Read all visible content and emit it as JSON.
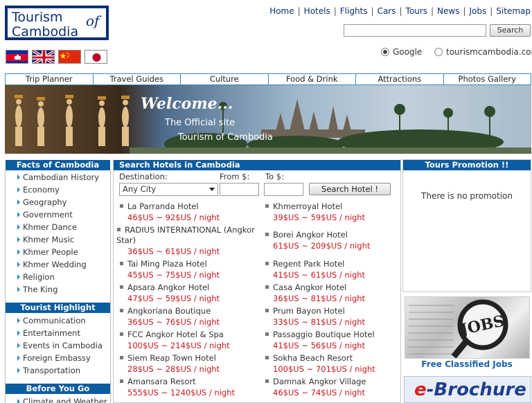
{
  "logo": {
    "line1": "Tourism",
    "line2": "Cambodia",
    "suffix": "of"
  },
  "topnav": [
    "Home",
    "Hotels",
    "Flights",
    "Cars",
    "Tours",
    "News",
    "Jobs",
    "Sitemap"
  ],
  "search": {
    "button": "Search",
    "value": ""
  },
  "search_scope": {
    "options": [
      "Google",
      "tourismcambodia.com"
    ],
    "selected": "Google"
  },
  "languages": [
    "khmer-flag-icon",
    "uk-flag-icon",
    "china-flag-icon",
    "japan-flag-icon"
  ],
  "main_menu": [
    "Trip Planner",
    "Travel Guides",
    "Culture",
    "Food & Drink",
    "Attractions",
    "Photos Gallery"
  ],
  "banner": {
    "welcome": "Welcome...",
    "line1": "The Official site",
    "line2": "Tourism of Cambodia"
  },
  "facts": {
    "title": "Facts of Cambodia",
    "items": [
      "Cambodian History",
      "Economy",
      "Geography",
      "Government",
      "Khmer Dance",
      "Khmer Music",
      "Khmer People",
      "Khmer Wedding",
      "Religion",
      "The King"
    ]
  },
  "highlight": {
    "title": "Tourist Highlight",
    "items": [
      "Communication",
      "Entertainment",
      "Events in Cambodia",
      "Foreign Embassy",
      "Transportation"
    ]
  },
  "before_you_go": {
    "title": "Before You Go",
    "items": [
      "Climate and Weather"
    ]
  },
  "hotel_search": {
    "title": "Search Hotels in Cambodia",
    "destination_label": "Destination:",
    "from_label": "From $:",
    "to_label": "To $:",
    "destination_value": "Any City",
    "button": "Search Hotel !",
    "hotels_left": [
      {
        "name": "La Parranda Hotel",
        "price": "46$US ~ 92$US / night"
      },
      {
        "name": "RADIUS INTERNATIONAL (Angkor",
        "name2": "Star)",
        "price": "36$US ~ 61$US / night"
      },
      {
        "name": "Tai Ming Plaza Hotel",
        "price": "45$US ~ 75$US / night"
      },
      {
        "name": "Apsara Angkor Hotel",
        "price": "47$US ~ 59$US / night"
      },
      {
        "name": "Angkoriana Boutique",
        "price": "36$US ~ 76$US / night"
      },
      {
        "name": "FCC Angkor Hotel & Spa",
        "price": "100$US ~ 214$US / night"
      },
      {
        "name": "Siem Reap Town Hotel",
        "price": "28$US ~ 28$US / night"
      },
      {
        "name": "Amansara Resort",
        "price": "555$US ~ 1240$US / night"
      }
    ],
    "hotels_right": [
      {
        "name": "Khmerroyal Hotel",
        "price": "39$US ~ 59$US / night"
      },
      {
        "name": "Borei Angkor Hotel",
        "price": "61$US ~ 209$US / night"
      },
      {
        "name": "Regent Park Hotel",
        "price": "41$US ~ 61$US / night"
      },
      {
        "name": "Casa Angkor Hotel",
        "price": "36$US ~ 81$US / night"
      },
      {
        "name": "Prum Bayon Hotel",
        "price": "33$US ~ 81$US / night"
      },
      {
        "name": "Passaggio Boutique Hotel",
        "price": "41$US ~ 56$US / night"
      },
      {
        "name": "Sokha Beach Resort",
        "price": "100$US ~ 701$US / night"
      },
      {
        "name": "Damnak Angkor Village",
        "price": "46$US ~ 74$US / night"
      }
    ]
  },
  "promo": {
    "title": "Tours Promotion !!",
    "text": "There is no promotion"
  },
  "jobs": {
    "image_text": "JOBS",
    "caption": "Free Classified Jobs"
  },
  "brochure": {
    "e": "e",
    "rest": "-Brochure"
  },
  "colors": {
    "header_blue": "#0b5ca1",
    "price_red": "#c8161d",
    "menu_border": "#3a8cb4"
  }
}
